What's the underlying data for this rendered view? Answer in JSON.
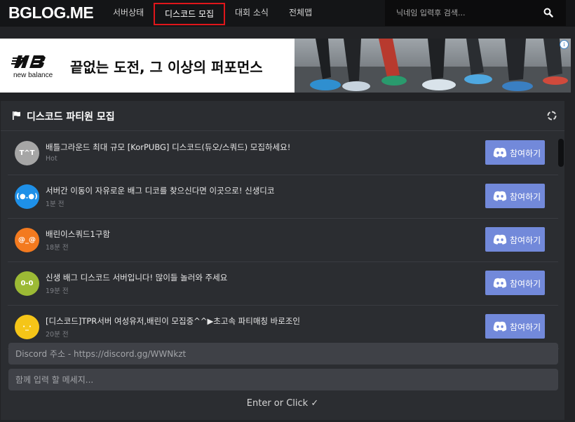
{
  "header": {
    "logo": "BGLOG.ME",
    "nav": [
      {
        "label": "서버상태"
      },
      {
        "label": "디스코드 모집",
        "active": true
      },
      {
        "label": "대회 소식"
      },
      {
        "label": "전체맵"
      }
    ],
    "search_placeholder": "닉네임 입력후 검색..."
  },
  "banner": {
    "brand": "new balance",
    "slogan": "끝없는 도전, 그 이상의 퍼포먼스",
    "ad_badge": "i"
  },
  "panel": {
    "title": "디스코드 파티원 모집",
    "join_label": "참여하기",
    "items": [
      {
        "avatar_text": "T^T",
        "avatar_color": "#a6a6a6",
        "title": "배틀그라운드 최대 규모 [KorPUBG] 디스코드(듀오/스쿼드) 모집하세요!",
        "time": "Hot"
      },
      {
        "avatar_text": "(●.●)",
        "avatar_color": "#1e90e8",
        "title": "서버간 이동이 자유로운 배그 디코를 찾으신다면 이곳으로! 신생디코",
        "time": "1분 전"
      },
      {
        "avatar_text": "@_@",
        "avatar_color": "#f37a1f",
        "title": "배린이스쿼드1구함",
        "time": "18분 전"
      },
      {
        "avatar_text": "0-0",
        "avatar_color": "#9cba35",
        "title": "신생 배그 디스코드 서버입니다! 많이들 놀러와 주세요",
        "time": "19분 전"
      },
      {
        "avatar_text": "·_·",
        "avatar_color": "#f5c518",
        "title": "[디스코드]TPR서버 여성유저,배린이 모집중^^▶초고속 파티매칭 바로조인",
        "time": "20분 전"
      }
    ]
  },
  "form": {
    "discord_url_placeholder": "Discord 주소 - https://discord.gg/WWNkzt",
    "message_placeholder": "함께 입력 할 메세지...",
    "submit_label": "Enter or Click ✓"
  }
}
